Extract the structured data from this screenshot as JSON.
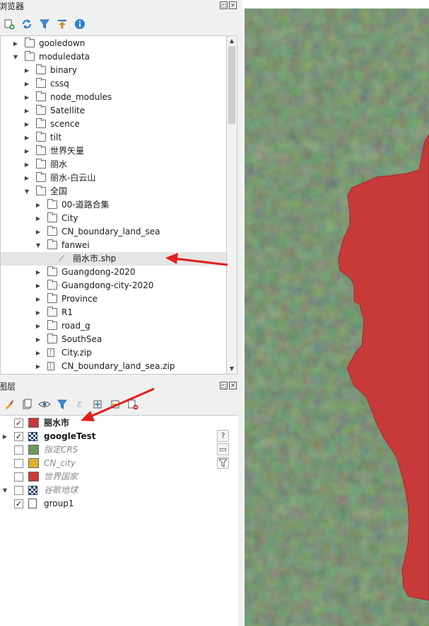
{
  "browser_panel": {
    "title": "浏览器",
    "tree": [
      {
        "label": "gooledown",
        "depth": 1,
        "expanded": false,
        "icon": "folder-icon"
      },
      {
        "label": "moduledata",
        "depth": 1,
        "expanded": true,
        "icon": "folder-open-icon"
      },
      {
        "label": "binary",
        "depth": 2,
        "expanded": false,
        "icon": "folder-icon"
      },
      {
        "label": "cssq",
        "depth": 2,
        "expanded": false,
        "icon": "folder-icon"
      },
      {
        "label": "node_modules",
        "depth": 2,
        "expanded": false,
        "icon": "folder-icon"
      },
      {
        "label": "Satellite",
        "depth": 2,
        "expanded": false,
        "icon": "folder-icon"
      },
      {
        "label": "scence",
        "depth": 2,
        "expanded": false,
        "icon": "folder-icon"
      },
      {
        "label": "tilt",
        "depth": 2,
        "expanded": false,
        "icon": "folder-icon"
      },
      {
        "label": "世界矢量",
        "depth": 2,
        "expanded": false,
        "icon": "folder-icon"
      },
      {
        "label": "丽水",
        "depth": 2,
        "expanded": false,
        "icon": "folder-icon"
      },
      {
        "label": "丽水-白云山",
        "depth": 2,
        "expanded": false,
        "icon": "folder-icon"
      },
      {
        "label": "全国",
        "depth": 2,
        "expanded": true,
        "icon": "folder-open-icon"
      },
      {
        "label": "00-道路合集",
        "depth": 3,
        "expanded": false,
        "icon": "folder-icon"
      },
      {
        "label": "City",
        "depth": 3,
        "expanded": false,
        "icon": "folder-icon"
      },
      {
        "label": "CN_boundary_land_sea",
        "depth": 3,
        "expanded": false,
        "icon": "folder-icon"
      },
      {
        "label": "fanwei",
        "depth": 3,
        "expanded": true,
        "icon": "folder-open-icon"
      },
      {
        "label": "丽水市.shp",
        "depth": 4,
        "expanded": null,
        "icon": "shapefile-icon",
        "selected": true
      },
      {
        "label": "Guangdong-2020",
        "depth": 3,
        "expanded": false,
        "icon": "folder-icon"
      },
      {
        "label": "Guangdong-city-2020",
        "depth": 3,
        "expanded": false,
        "icon": "folder-icon"
      },
      {
        "label": "Province",
        "depth": 3,
        "expanded": false,
        "icon": "folder-icon"
      },
      {
        "label": "R1",
        "depth": 3,
        "expanded": false,
        "icon": "folder-icon"
      },
      {
        "label": "road_g",
        "depth": 3,
        "expanded": false,
        "icon": "folder-icon"
      },
      {
        "label": "SouthSea",
        "depth": 3,
        "expanded": false,
        "icon": "folder-icon"
      },
      {
        "label": "City.zip",
        "depth": 3,
        "expanded": false,
        "icon": "zip-icon"
      },
      {
        "label": "CN_boundary_land_sea.zip",
        "depth": 3,
        "expanded": false,
        "icon": "zip-icon"
      }
    ]
  },
  "layers_panel": {
    "title": "图层",
    "layers": [
      {
        "label": "丽水市",
        "checked": true,
        "style": "bold",
        "icon": "polygon-swatch",
        "color": "#c83a3a",
        "expandable": false
      },
      {
        "label": "googleTest",
        "checked": true,
        "style": "bold",
        "icon": "raster-icon",
        "color": "",
        "expandable": true
      },
      {
        "label": "指定CRS",
        "checked": false,
        "style": "muted",
        "icon": "polygon-swatch",
        "color": "#6a9a5c",
        "expandable": false
      },
      {
        "label": "CN_city",
        "checked": false,
        "style": "muted",
        "icon": "polygon-swatch",
        "color": "#e0b030",
        "expandable": false
      },
      {
        "label": "世界国家",
        "checked": false,
        "style": "muted",
        "icon": "polygon-swatch",
        "color": "#c83a3a",
        "expandable": false
      },
      {
        "label": "谷歌地球",
        "checked": false,
        "style": "muted",
        "icon": "raster-icon",
        "color": "",
        "expandable": true
      },
      {
        "label": "group1",
        "checked": true,
        "style": "normal",
        "icon": "group-icon",
        "color": "",
        "expandable": false
      }
    ]
  },
  "colors": {
    "highlight_polygon": "#c83a3a",
    "annotation_arrow": "#e02020",
    "satellite_dark": "#2f4a2c"
  }
}
